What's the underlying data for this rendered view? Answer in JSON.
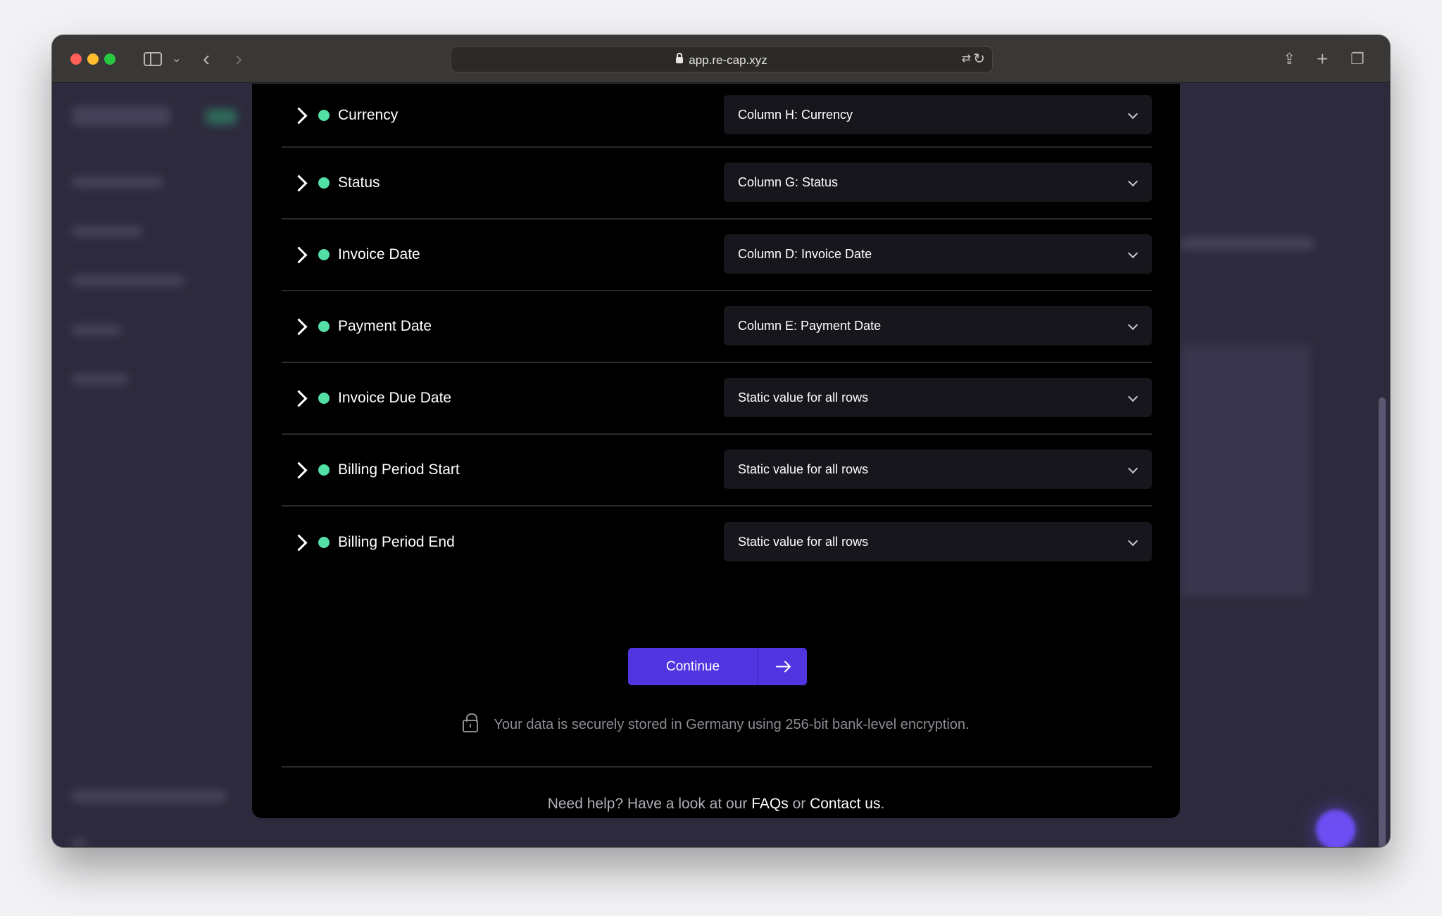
{
  "browser": {
    "url": "app.re-cap.xyz"
  },
  "mapping_rows": [
    {
      "label": "Currency",
      "selected": "Column H: Currency"
    },
    {
      "label": "Status",
      "selected": "Column G: Status"
    },
    {
      "label": "Invoice Date",
      "selected": "Column D: Invoice Date"
    },
    {
      "label": "Payment Date",
      "selected": "Column E: Payment Date"
    },
    {
      "label": "Invoice Due Date",
      "selected": "Static value for all rows"
    },
    {
      "label": "Billing Period Start",
      "selected": "Static value for all rows"
    },
    {
      "label": "Billing Period End",
      "selected": "Static value for all rows"
    }
  ],
  "continue_button": {
    "label": "Continue"
  },
  "security_note": "Your data is securely stored in Germany using 256-bit bank-level encryption.",
  "help": {
    "prefix": "Need help? Have a look at our ",
    "faqs_link": "FAQs",
    "middle": " or ",
    "contact_link": "Contact us",
    "suffix": "."
  },
  "colors": {
    "accent": "#5135e0",
    "status_dot": "#52e0a5",
    "modal_bg": "#000000"
  }
}
